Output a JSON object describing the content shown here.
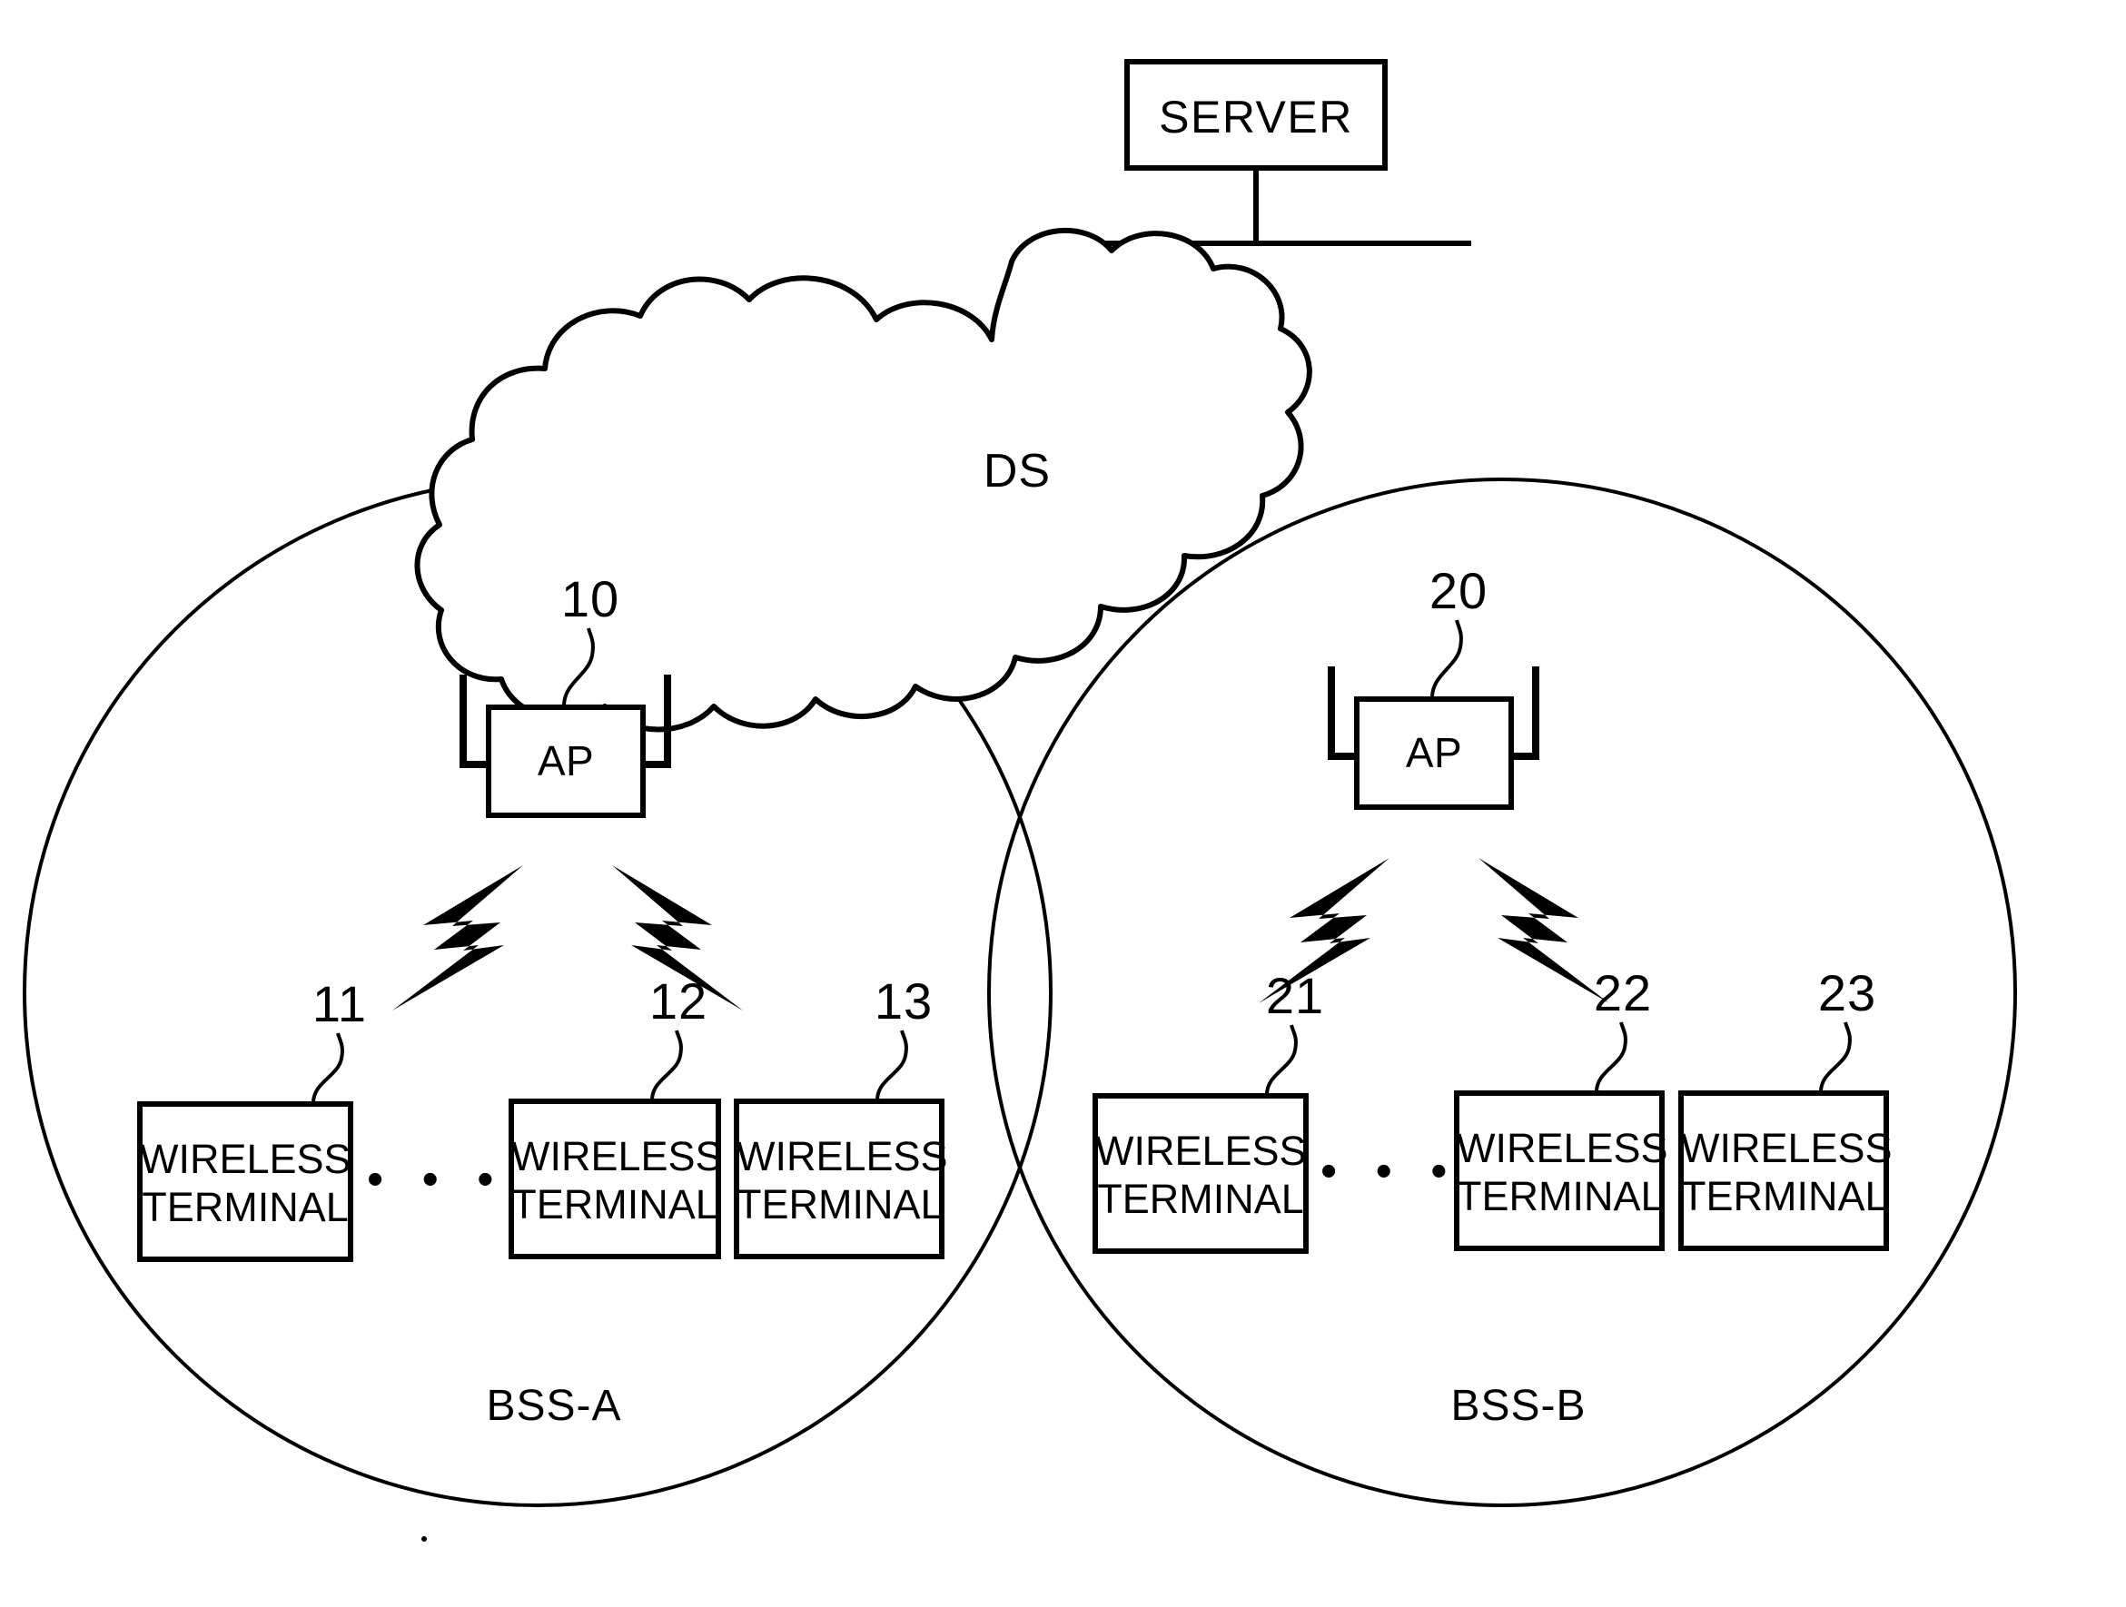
{
  "diagram": {
    "type": "wireless-lan-network-topology",
    "server": {
      "label": "SERVER"
    },
    "distribution_system": {
      "label": "DS"
    },
    "cells": [
      {
        "name": "BSS-A",
        "label": "BSS-A",
        "access_point": {
          "label": "AP",
          "ref": "10"
        },
        "terminals": [
          {
            "label": "WIRELESS\nTERMINAL",
            "line1": "WIRELESS",
            "line2": "TERMINAL",
            "ref": "11"
          },
          {
            "label": "WIRELESS\nTERMINAL",
            "line1": "WIRELESS",
            "line2": "TERMINAL",
            "ref": "12"
          },
          {
            "label": "WIRELESS\nTERMINAL",
            "line1": "WIRELESS",
            "line2": "TERMINAL",
            "ref": "13"
          }
        ],
        "ellipsis": "• • •"
      },
      {
        "name": "BSS-B",
        "label": "BSS-B",
        "access_point": {
          "label": "AP",
          "ref": "20"
        },
        "terminals": [
          {
            "label": "WIRELESS\nTERMINAL",
            "line1": "WIRELESS",
            "line2": "TERMINAL",
            "ref": "21"
          },
          {
            "label": "WIRELESS\nTERMINAL",
            "line1": "WIRELESS",
            "line2": "TERMINAL",
            "ref": "22"
          },
          {
            "label": "WIRELESS\nTERMINAL",
            "line1": "WIRELESS",
            "line2": "TERMINAL",
            "ref": "23"
          }
        ],
        "ellipsis": "• • •"
      }
    ],
    "colors": {
      "ink": "#000000",
      "paper": "#ffffff"
    }
  }
}
